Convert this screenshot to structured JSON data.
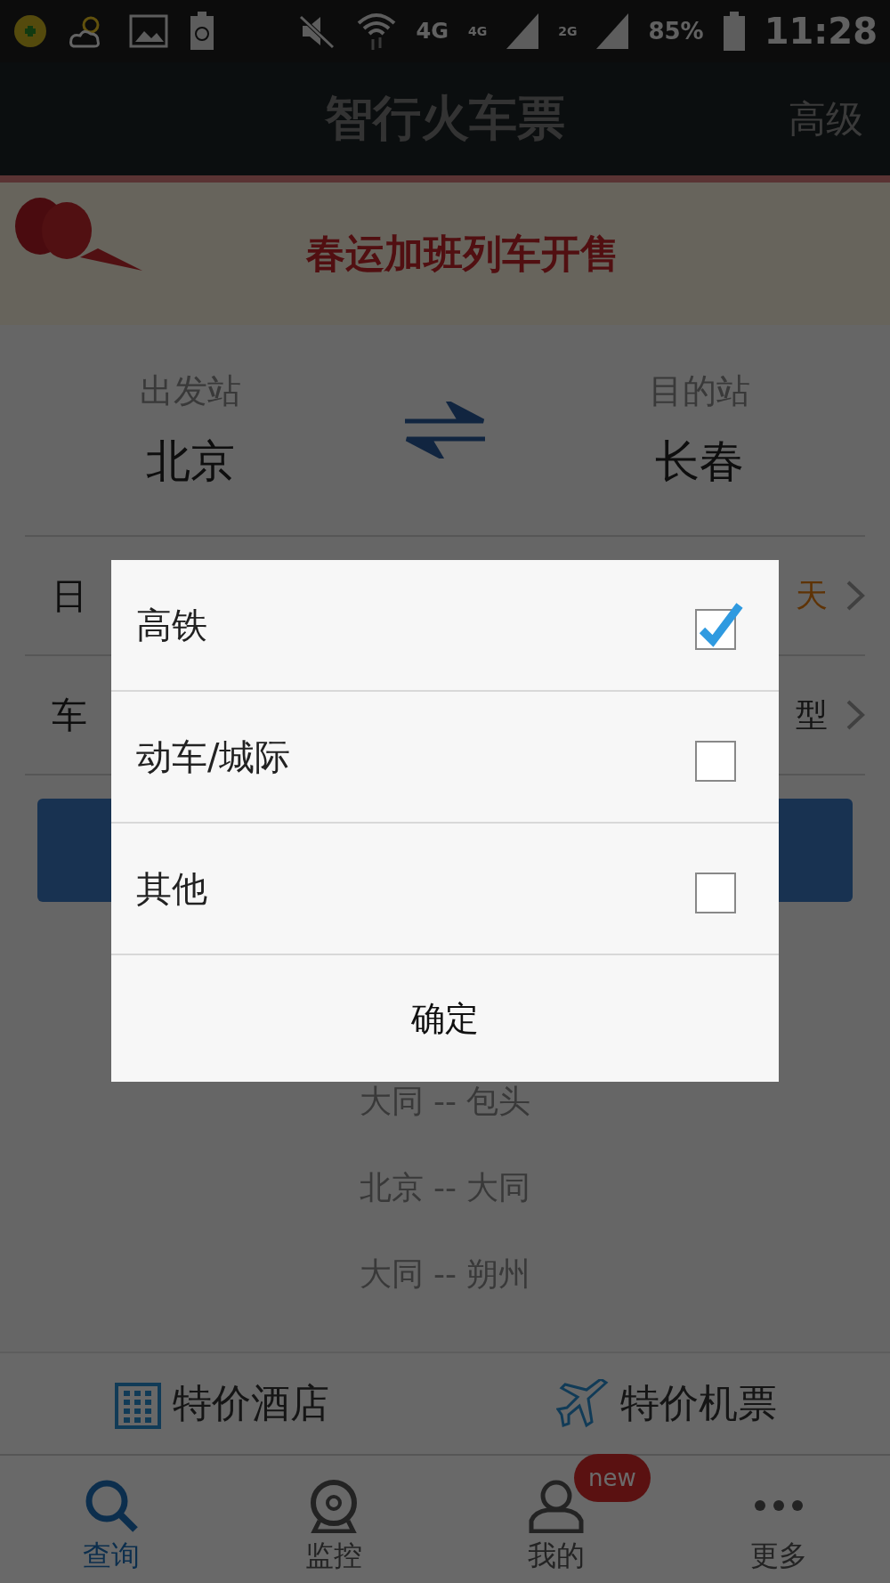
{
  "status_bar": {
    "network": "4G",
    "sim1": "4G",
    "sim2": "2G",
    "battery": "85%",
    "time": "11:28"
  },
  "header": {
    "title": "智行火车票",
    "action": "高级"
  },
  "banner": {
    "text": "春运加班列车开售"
  },
  "stations": {
    "from_label": "出发站",
    "from": "北京",
    "to_label": "目的站",
    "to": "长春"
  },
  "options": [
    {
      "kind": "date",
      "label": "日",
      "value": "天"
    },
    {
      "kind": "type",
      "label": "车",
      "value": "型"
    }
  ],
  "history": [
    "大同 -- 包头",
    "北京 -- 大同",
    "大同 -- 朔州"
  ],
  "promos": [
    {
      "kind": "hotel",
      "label": "特价酒店"
    },
    {
      "kind": "flight",
      "label": "特价机票"
    }
  ],
  "tabs": [
    {
      "kind": "search",
      "label": "查询",
      "selected": true
    },
    {
      "kind": "monitor",
      "label": "监控",
      "selected": false
    },
    {
      "kind": "me",
      "label": "我的",
      "selected": false,
      "badge": "new"
    },
    {
      "kind": "more",
      "label": "更多",
      "selected": false
    }
  ],
  "dialog": {
    "items": [
      {
        "label": "高铁",
        "checked": true
      },
      {
        "label": "动车/城际",
        "checked": false
      },
      {
        "label": "其他",
        "checked": false
      }
    ],
    "confirm": "确定"
  }
}
